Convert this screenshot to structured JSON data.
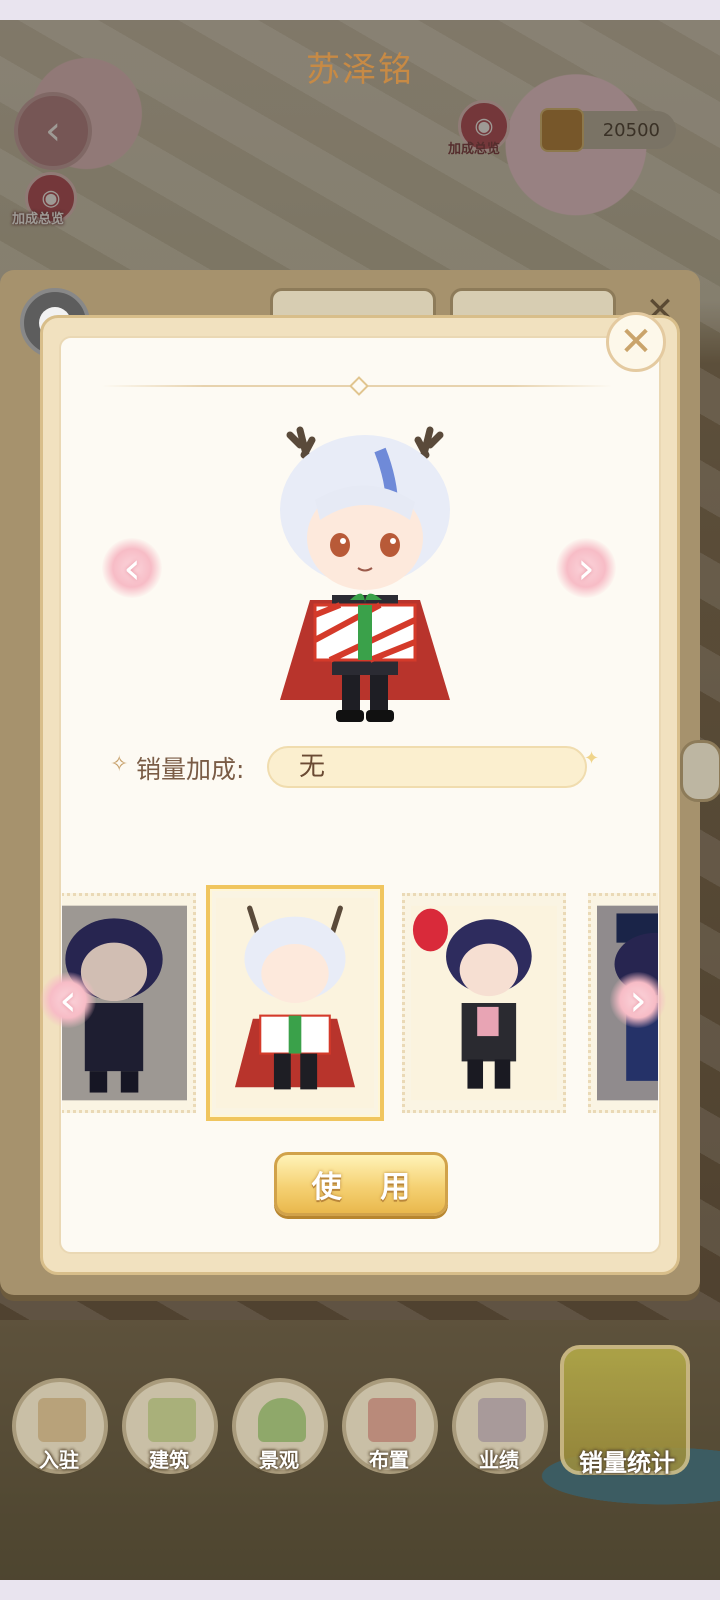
{
  "hud": {
    "left_overview_label": "加成总览",
    "right_overview_label": "加成总览",
    "coin_amount": "20500"
  },
  "modal": {
    "character_name": "苏泽铭",
    "sales_bonus_label": "销量加成:",
    "sales_bonus_value": "无",
    "use_button": "使 用"
  },
  "outfits": [
    {
      "name": "outfit-dark-uniform",
      "selected": false
    },
    {
      "name": "outfit-christmas-reindeer",
      "selected": true
    },
    {
      "name": "outfit-valentine",
      "selected": false
    },
    {
      "name": "outfit-navy-hat",
      "selected": false
    }
  ],
  "bottom_nav": [
    {
      "label": "入驻",
      "icon": "shop-icon"
    },
    {
      "label": "建筑",
      "icon": "building-icon"
    },
    {
      "label": "景观",
      "icon": "tree-icon"
    },
    {
      "label": "布置",
      "icon": "decor-icon"
    },
    {
      "label": "业绩",
      "icon": "chart-icon"
    }
  ],
  "sales_stats_label": "销量统计",
  "colors": {
    "title": "#c78a45",
    "accent_gold": "#f0c55e",
    "arrow_pink": "#f7bcc6"
  }
}
